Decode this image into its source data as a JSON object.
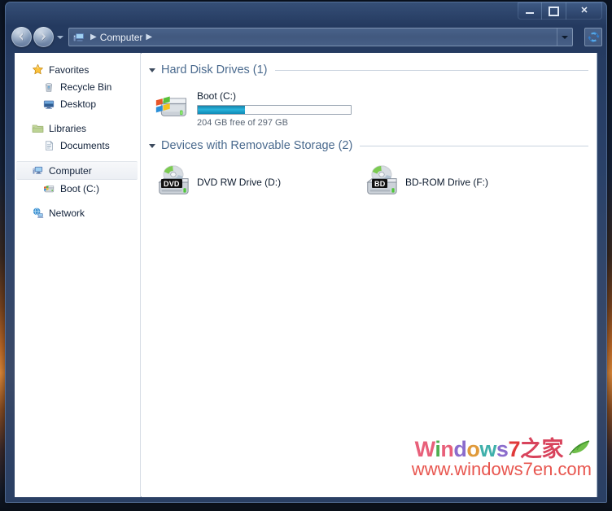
{
  "window": {
    "title": "Computer",
    "controls": {
      "minimize": "Minimize",
      "maximize": "Maximize",
      "close": "Close"
    }
  },
  "navbar": {
    "back_label": "Back",
    "forward_label": "Forward",
    "recent_pages_label": "Recent Pages",
    "breadcrumb": {
      "root_icon": "computer-icon",
      "items": [
        "Computer"
      ],
      "separator": "▶"
    },
    "history_dropdown_label": "Previous Locations",
    "refresh_label": "Refresh"
  },
  "sidebar": {
    "groups": [
      {
        "header": {
          "label": "Favorites",
          "icon": "star-icon"
        },
        "items": [
          {
            "label": "Recycle Bin",
            "icon": "recycle-bin-icon"
          },
          {
            "label": "Desktop",
            "icon": "desktop-icon"
          }
        ]
      },
      {
        "header": {
          "label": "Libraries",
          "icon": "library-folder-icon"
        },
        "items": [
          {
            "label": "Documents",
            "icon": "document-icon"
          }
        ]
      },
      {
        "header": {
          "label": "Computer",
          "icon": "computer-icon",
          "selected": true
        },
        "items": [
          {
            "label": "Boot (C:)",
            "icon": "hard-drive-icon"
          }
        ]
      },
      {
        "header": {
          "label": "Network",
          "icon": "network-icon"
        },
        "items": []
      }
    ]
  },
  "content": {
    "groups": [
      {
        "title": "Hard Disk Drives (1)",
        "count": 1,
        "items": [
          {
            "label": "Boot (C:)",
            "icon": "hard-drive-icon",
            "type": "harddisk",
            "capacity_total": "297 GB",
            "capacity_free": "204 GB",
            "capacity_text": "204 GB free of 297 GB",
            "used_percent": 31,
            "bar_color": "#29b3dc"
          }
        ]
      },
      {
        "title": "Devices with Removable Storage (2)",
        "count": 2,
        "items": [
          {
            "label": "DVD RW Drive (D:)",
            "icon": "optical-drive-icon",
            "type": "optical",
            "badge": "DVD"
          },
          {
            "label": "BD-ROM Drive (F:)",
            "icon": "optical-drive-icon",
            "type": "optical",
            "badge": "BD"
          }
        ]
      }
    ]
  },
  "watermark": {
    "line1_parts": [
      {
        "text": "W",
        "color": "#e8607a"
      },
      {
        "text": "i",
        "color": "#4fae52"
      },
      {
        "text": "n",
        "color": "#e8607a"
      },
      {
        "text": "d",
        "color": "#8b6ccc"
      },
      {
        "text": "o",
        "color": "#e09a3a"
      },
      {
        "text": "w",
        "color": "#3fb0ab"
      },
      {
        "text": "s",
        "color": "#8b6ccc"
      },
      {
        "text": "7",
        "color": "#e03a3a"
      },
      {
        "text": "之",
        "color": "#d8435c"
      },
      {
        "text": "家",
        "color": "#d8435c"
      }
    ],
    "line1_plain": "Windows7之家",
    "line2": "www.windows7en.com"
  }
}
